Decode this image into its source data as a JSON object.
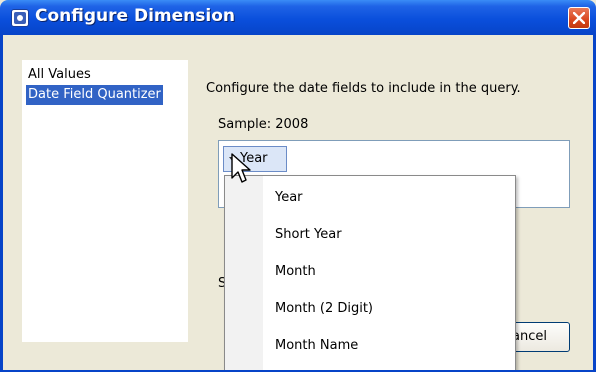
{
  "window": {
    "title": "Configure Dimension"
  },
  "left_list": {
    "items": [
      "All Values",
      "Date Field Quantizer"
    ],
    "selected_index": 1
  },
  "main": {
    "instruction": "Configure the date fields to include in the query.",
    "sample": "Sample: 2008",
    "field_chip": "Year",
    "partial_label": "S"
  },
  "dropdown": {
    "items": [
      "Year",
      "Short Year",
      "Month",
      "Month (2 Digit)",
      "Month Name"
    ]
  },
  "buttons": {
    "cancel": "Cancel"
  },
  "colors": {
    "titlebar": "#0a4fdc",
    "selection": "#3163c5",
    "chip": "#dbe6f7"
  }
}
